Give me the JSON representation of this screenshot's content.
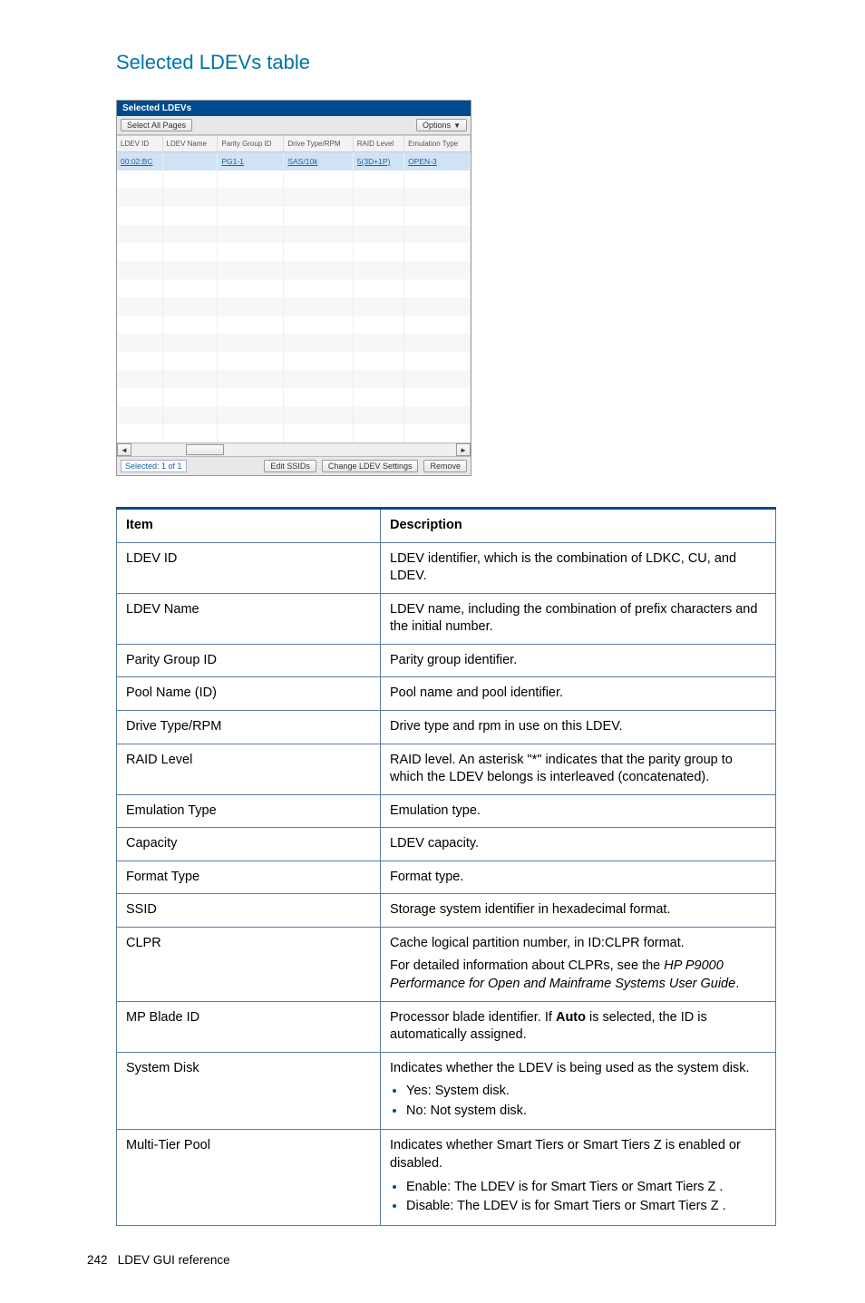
{
  "heading": "Selected LDEVs table",
  "screenshot": {
    "title": "Selected LDEVs",
    "select_all": "Select All Pages",
    "options": "Options",
    "columns": [
      "LDEV ID",
      "LDEV Name",
      "Parity Group ID",
      "Drive Type/RPM",
      "RAID Level",
      "Emulation Type"
    ],
    "row": {
      "ldev_id": "00:02:BC",
      "ldev_name": "",
      "parity_group": "PG1-1",
      "drive": "SAS/10k",
      "raid": "5(3D+1P)",
      "emulation": "OPEN-3"
    },
    "footer": {
      "selected": "Selected: 1   of  1",
      "edit_ssids": "Edit SSIDs",
      "change_ldev": "Change LDEV Settings",
      "remove": "Remove"
    }
  },
  "desc": {
    "header_item": "Item",
    "header_desc": "Description",
    "rows": [
      {
        "item": "LDEV ID",
        "desc": "LDEV identifier, which is the combination of LDKC, CU, and LDEV."
      },
      {
        "item": "LDEV Name",
        "desc": "LDEV name, including the combination of prefix characters and the initial number."
      },
      {
        "item": "Parity Group ID",
        "desc": "Parity group identifier."
      },
      {
        "item": "Pool Name (ID)",
        "desc": "Pool name and pool identifier."
      },
      {
        "item": "Drive Type/RPM",
        "desc": "Drive type and rpm in use on this LDEV."
      },
      {
        "item": "RAID Level",
        "desc": "RAID level. An asterisk \"*\" indicates that the parity group to which the LDEV belongs is interleaved (concatenated)."
      },
      {
        "item": "Emulation Type",
        "desc": "Emulation type."
      },
      {
        "item": "Capacity",
        "desc": "LDEV capacity."
      },
      {
        "item": "Format Type",
        "desc": "Format type."
      },
      {
        "item": "SSID",
        "desc": "Storage system identifier in hexadecimal format."
      }
    ],
    "clpr": {
      "item": "CLPR",
      "p1": "Cache logical partition number, in ID:CLPR format.",
      "p2a": "For detailed information about CLPRs, see the ",
      "p2b": "HP P9000 Performance for Open and Mainframe Systems User Guide",
      "p2c": "."
    },
    "mpblade": {
      "item": "MP Blade ID",
      "a": "Processor blade identifier. If ",
      "b": "Auto",
      "c": " is selected, the ID is automatically assigned."
    },
    "sysdisk": {
      "item": "System Disk",
      "intro": "Indicates whether the LDEV is being used as the system disk.",
      "li1": "Yes: System disk.",
      "li2": "No: Not system disk."
    },
    "multitier": {
      "item": "Multi-Tier Pool",
      "intro": "Indicates whether Smart Tiers or Smart Tiers Z is enabled or disabled.",
      "li1": "Enable: The LDEV is for Smart Tiers or Smart Tiers Z .",
      "li2": "Disable: The LDEV is for Smart Tiers or Smart Tiers Z ."
    }
  },
  "footer": {
    "page": "242",
    "section": "LDEV GUI reference"
  }
}
